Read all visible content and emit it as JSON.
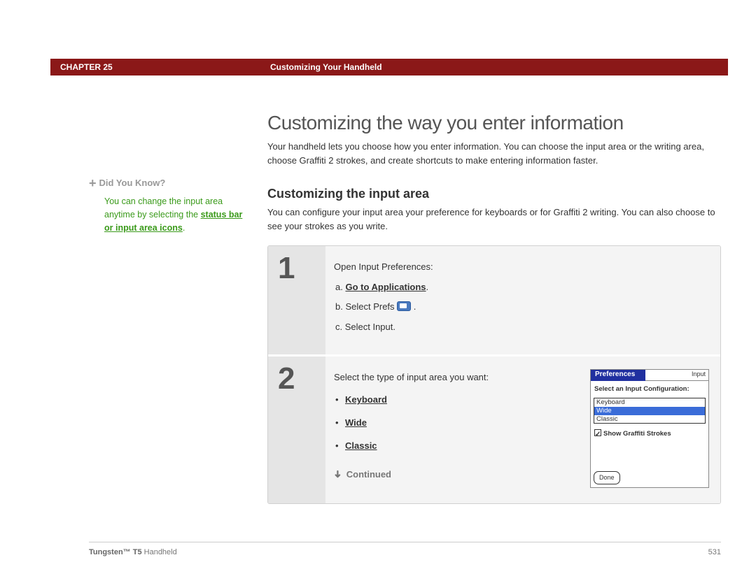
{
  "header": {
    "chapter": "CHAPTER 25",
    "title": "Customizing Your Handheld"
  },
  "sidebar": {
    "tip_heading": "Did You Know?",
    "tip_text_before": "You can change the input area anytime by selecting the ",
    "tip_link": "status bar or input area icons",
    "tip_text_after": "."
  },
  "main": {
    "h1": "Customizing the way you enter information",
    "intro": "Your handheld lets you choose how you enter information. You can choose the input area or the writing area, choose Graffiti 2 strokes, and create shortcuts to make entering information faster.",
    "h2": "Customizing the input area",
    "subintro": "You can configure your input area your preference for keyboards or for Graffiti 2 writing. You can also choose to see your strokes as you write."
  },
  "step1": {
    "num": "1",
    "lead": "Open Input Preferences:",
    "a_prefix": "a.  ",
    "a_link": "Go to Applications",
    "a_suffix": ".",
    "b_prefix": "b.  Select Prefs ",
    "b_suffix": " .",
    "c": "c.  Select Input."
  },
  "step2": {
    "num": "2",
    "lead": "Select the type of input area you want:",
    "opt1": "Keyboard",
    "opt2": "Wide",
    "opt3": "Classic",
    "continued": "Continued"
  },
  "prefs": {
    "title": "Preferences",
    "category": "Input",
    "label": "Select an Input Configuration:",
    "options": [
      "Keyboard",
      "Wide",
      "Classic"
    ],
    "selected_index": 1,
    "checkbox": "Show Graffiti Strokes",
    "done": "Done"
  },
  "footer": {
    "product_bold": "Tungsten™ T5",
    "product_rest": " Handheld",
    "page": "531"
  }
}
